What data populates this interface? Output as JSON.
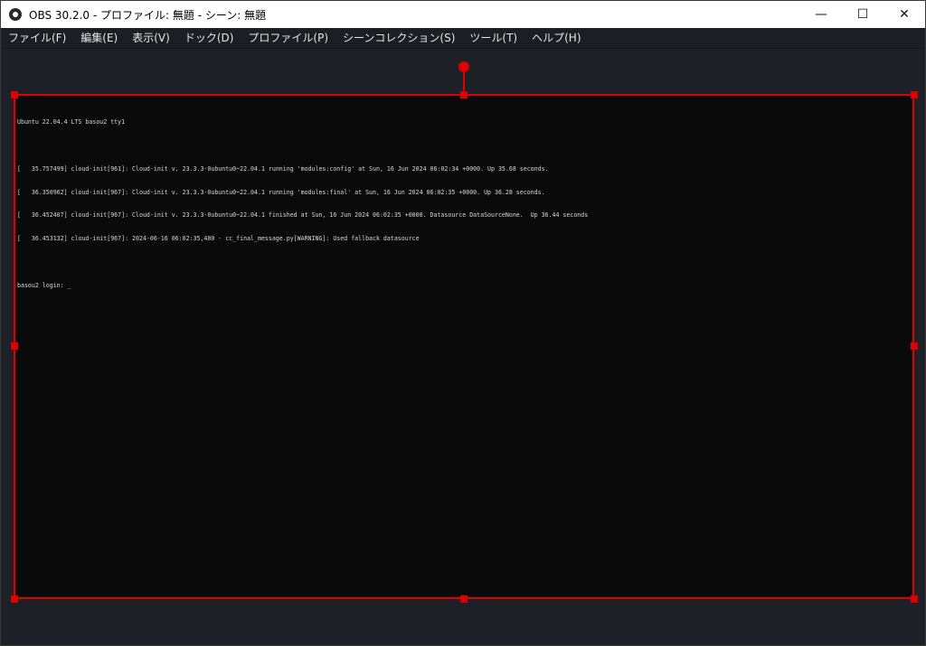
{
  "window": {
    "title": "OBS 30.2.0 - プロファイル: 無題 - シーン: 無題",
    "controls": {
      "minimize": "—",
      "maximize": "☐",
      "close": "✕"
    }
  },
  "menubar": {
    "items": [
      {
        "label": "ファイル(F)"
      },
      {
        "label": "編集(E)"
      },
      {
        "label": "表示(V)"
      },
      {
        "label": "ドック(D)"
      },
      {
        "label": "プロファイル(P)"
      },
      {
        "label": "シーンコレクション(S)"
      },
      {
        "label": "ツール(T)"
      },
      {
        "label": "ヘルプ(H)"
      }
    ]
  },
  "colors": {
    "selection": "#e00000",
    "background": "#1c1e26",
    "console_bg": "#0a0a0a"
  },
  "console": {
    "header": "Ubuntu 22.04.4 LTS basou2 tty1",
    "lines": [
      "[   35.757499] cloud-init[961]: Cloud-init v. 23.3.3-0ubuntu0~22.04.1 running 'modules:config' at Sun, 16 Jun 2024 06:02:34 +0000. Up 35.68 seconds.",
      "[   36.350962] cloud-init[967]: Cloud-init v. 23.3.3-0ubuntu0~22.04.1 running 'modules:final' at Sun, 16 Jun 2024 06:02:35 +0000. Up 36.28 seconds.",
      "[   36.452407] cloud-init[967]: Cloud-init v. 23.3.3-0ubuntu0~22.04.1 finished at Sun, 16 Jun 2024 06:02:35 +0000. Datasource DataSourceNone.  Up 36.44 seconds",
      "[   36.453132] cloud-init[967]: 2024-06-16 06:02:35,480 - cc_final_message.py[WARNING]: Used fallback datasource"
    ],
    "prompt": "basou2 login: _"
  }
}
